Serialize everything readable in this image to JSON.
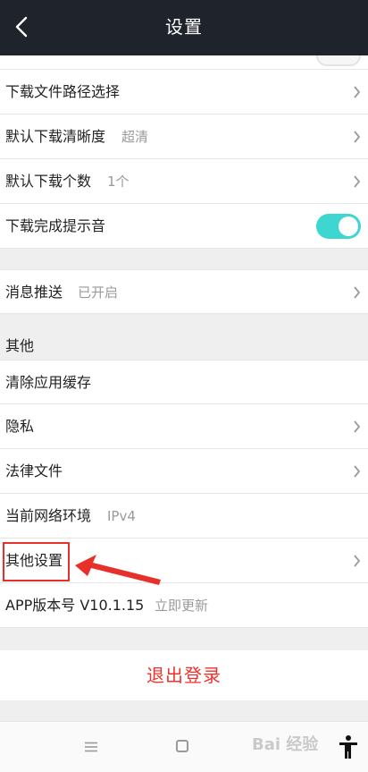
{
  "header": {
    "title": "设置"
  },
  "download": {
    "path_label": "下载文件路径选择",
    "quality_label": "默认下载清晰度",
    "quality_value": "超清",
    "count_label": "默认下载个数",
    "count_value": "1个",
    "sound_label": "下载完成提示音",
    "sound_on": true
  },
  "push": {
    "label": "消息推送",
    "value": "已开启"
  },
  "other": {
    "section_title": "其他",
    "clear_cache": "清除应用缓存",
    "privacy": "隐私",
    "legal": "法律文件",
    "network_label": "当前网络环境",
    "network_value": "IPv4",
    "other_settings": "其他设置",
    "version_label": "APP版本号 V10.1.15",
    "update_link": "立即更新"
  },
  "logout": {
    "label": "退出登录"
  },
  "watermark": {
    "text": "Bai 经验"
  },
  "colors": {
    "header_bg": "#1f232b",
    "toggle_on": "#3ed6d0",
    "link": "#2d8cf0",
    "logout": "#f0322d",
    "annotation": "#e8302a"
  },
  "icons": [
    "back-arrow-icon",
    "chevron-right-icon",
    "menu-icon",
    "home-icon",
    "accessibility-icon"
  ]
}
